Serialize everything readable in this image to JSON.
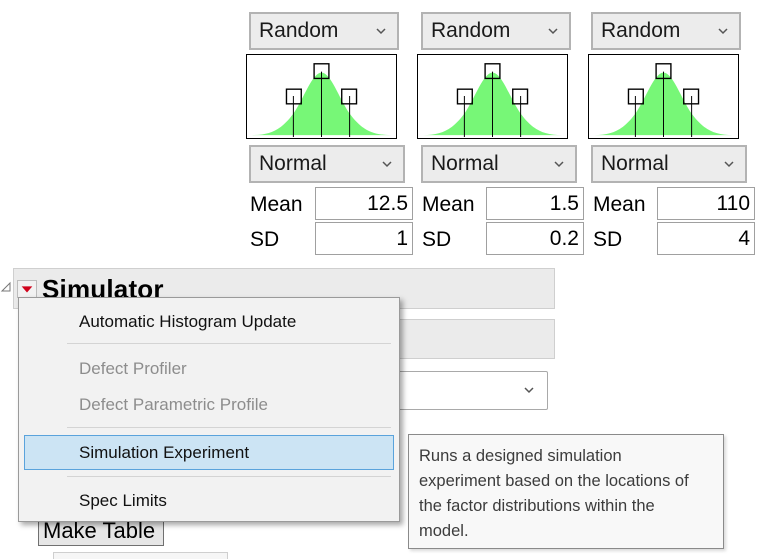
{
  "factors": [
    {
      "method": "Random",
      "distribution": "Normal",
      "mean_label": "Mean",
      "mean": "12.5",
      "sd_label": "SD",
      "sd": "1"
    },
    {
      "method": "Random",
      "distribution": "Normal",
      "mean_label": "Mean",
      "mean": "1.5",
      "sd_label": "SD",
      "sd": "0.2"
    },
    {
      "method": "Random",
      "distribution": "Normal",
      "mean_label": "Mean",
      "mean": "110",
      "sd_label": "SD",
      "sd": "4"
    }
  ],
  "simulator": {
    "title": "Simulator",
    "make_table": "Make Table"
  },
  "menu": {
    "items": [
      "Automatic Histogram Update",
      "Defect Profiler",
      "Defect Parametric Profile",
      "Simulation Experiment",
      "Spec Limits"
    ],
    "highlighted": "Simulation Experiment"
  },
  "tooltip": {
    "lines": [
      "Runs a designed simulation",
      "experiment based on the locations of",
      "the factor distributions within the",
      "model."
    ]
  },
  "colors": {
    "curve_fill": "#77f777",
    "menu_highlight": "#cce4f4",
    "menu_highlight_border": "#5aa3dc",
    "red_triangle": "#d0021b"
  }
}
